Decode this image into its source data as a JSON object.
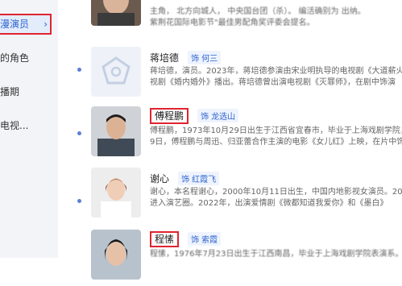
{
  "sidebar": {
    "active_label": "漫演员",
    "active_chevron": "›",
    "items": [
      "的角色",
      "播期",
      "电视..."
    ]
  },
  "top_text": {
    "line1": "主角，  北方向城人，  中央国台团（杀）。  编活确别为  出纳。",
    "line2": "紫荆花国际电影节\"最佳男配角奖评委会提名。"
  },
  "cards": [
    {
      "name": "蒋培德",
      "role": "何三",
      "line1": "蒋培德，演员。2023年，蒋培德参演由宋业明执导的电视剧《大道薪火",
      "line2": "视剧《婚内婚外》播出。蒋培德曾出演电视剧《灭罪师》，在剧中饰演"
    },
    {
      "name": "傅程鹏",
      "role": "龙选山",
      "line1": "傅程鹏，1973年10月29日出生于江西省宜春市，毕业于上海戏剧学院，",
      "line2": "9日，傅程鹏与周迅、归亚蕾合作主演的电影《女儿红》上映，在片中饰演"
    },
    {
      "name": "谢心",
      "role": "红霞飞",
      "line1": "谢心，本名程谢心，2000年10月11日出生，中国内地影视女演员。20",
      "line2": "进入演艺圈。2022年，出演爱情剧《微都知道我爱你》和《墨白》"
    },
    {
      "name": "程愫",
      "role": "索霞",
      "line1": "程愫，1976年7月23日出生于江西南昌，毕业于上海戏剧学院表演系。"
    }
  ],
  "tag_prefix": "饰",
  "colors": {
    "accent": "#2d64d0",
    "highlight_border": "#e0242f",
    "sidebar_bg": "#f2f4f7"
  }
}
